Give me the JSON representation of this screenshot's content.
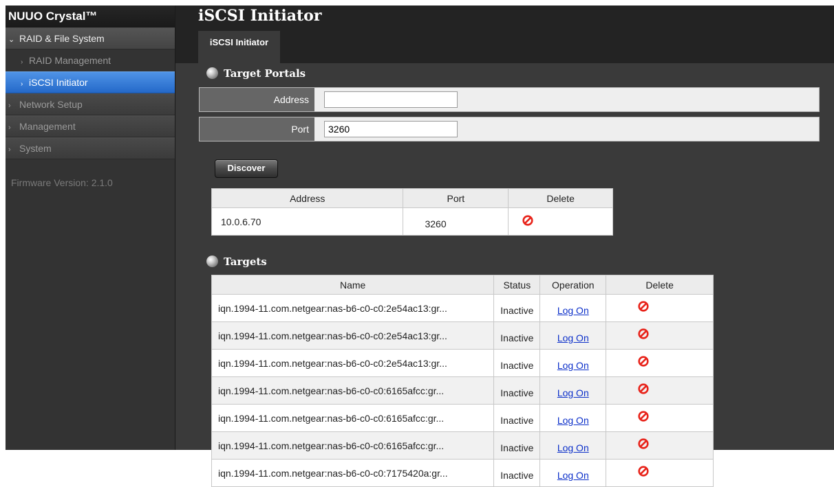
{
  "app": {
    "brand": "NUUO Crystal™"
  },
  "sidebar": {
    "groups": [
      {
        "label": "RAID & File System",
        "chevron": "v"
      },
      {
        "label": "Network Setup",
        "chevron": ">"
      },
      {
        "label": "Management",
        "chevron": ">"
      },
      {
        "label": "System",
        "chevron": ">"
      }
    ],
    "sub_items": [
      {
        "label": "RAID Management"
      },
      {
        "label": "iSCSI Initiator"
      }
    ],
    "firmware": "Firmware Version: 2.1.0"
  },
  "header": {
    "title": "iSCSI Initiator",
    "tab": "iSCSI Initiator"
  },
  "target_portals": {
    "title": "Target Portals",
    "address_label": "Address",
    "address_value": "",
    "port_label": "Port",
    "port_value": "3260",
    "discover_label": "Discover"
  },
  "portal_table": {
    "headers": [
      "Address",
      "Port",
      "Delete"
    ],
    "rows": [
      {
        "address": "10.0.6.70",
        "port": "3260"
      }
    ]
  },
  "targets": {
    "title": "Targets",
    "headers": [
      "Name",
      "Status",
      "Operation",
      "Delete"
    ],
    "rows": [
      {
        "name": "iqn.1994-11.com.netgear:nas-b6-c0-c0:2e54ac13:gr...",
        "status": "Inactive",
        "operation": "Log On"
      },
      {
        "name": "iqn.1994-11.com.netgear:nas-b6-c0-c0:2e54ac13:gr...",
        "status": "Inactive",
        "operation": "Log On"
      },
      {
        "name": "iqn.1994-11.com.netgear:nas-b6-c0-c0:2e54ac13:gr...",
        "status": "Inactive",
        "operation": "Log On"
      },
      {
        "name": "iqn.1994-11.com.netgear:nas-b6-c0-c0:6165afcc:gr...",
        "status": "Inactive",
        "operation": "Log On"
      },
      {
        "name": "iqn.1994-11.com.netgear:nas-b6-c0-c0:6165afcc:gr...",
        "status": "Inactive",
        "operation": "Log On"
      },
      {
        "name": "iqn.1994-11.com.netgear:nas-b6-c0-c0:6165afcc:gr...",
        "status": "Inactive",
        "operation": "Log On"
      },
      {
        "name": "iqn.1994-11.com.netgear:nas-b6-c0-c0:7175420a:gr...",
        "status": "Inactive",
        "operation": "Log On"
      }
    ]
  },
  "colors": {
    "accent": "#2f74d0",
    "delete_icon": "#e8231a",
    "link": "#0a2ec9"
  }
}
